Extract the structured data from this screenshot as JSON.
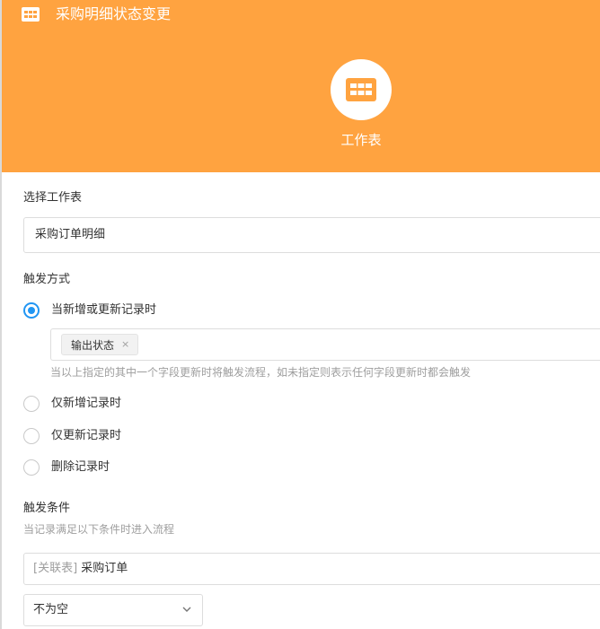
{
  "header": {
    "title": "采购明细状态变更",
    "node_label": "工作表",
    "color": "#ffa340",
    "icon": "grid-table-icon"
  },
  "worksheet": {
    "label": "选择工作表",
    "value": "采购订单明细"
  },
  "trigger": {
    "label": "触发方式",
    "options": [
      {
        "label": "当新增或更新记录时",
        "checked": true
      },
      {
        "label": "仅新增记录时",
        "checked": false
      },
      {
        "label": "仅更新记录时",
        "checked": false
      },
      {
        "label": "删除记录时",
        "checked": false
      }
    ],
    "fields": [
      {
        "label": "输出状态",
        "close": "×"
      }
    ],
    "hint": "当以上指定的其中一个字段更新时将触发流程，如未指定则表示任何字段更新时都会触发"
  },
  "condition": {
    "label": "触发条件",
    "hint": "当记录满足以下条件时进入流程",
    "field_prefix": "[关联表]",
    "field_name": "采购订单",
    "operator": "不为空"
  },
  "colors": {
    "accent": "#2196f3",
    "header": "#ffa340",
    "muted_text": "#9e9e9e"
  }
}
